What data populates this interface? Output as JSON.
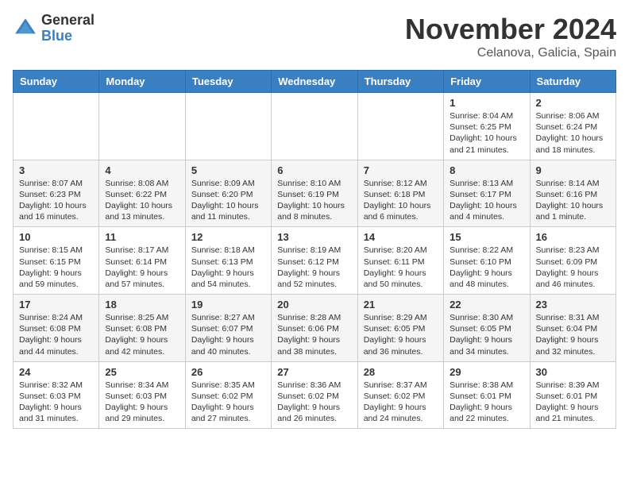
{
  "logo": {
    "general": "General",
    "blue": "Blue"
  },
  "header": {
    "title": "November 2024",
    "location": "Celanova, Galicia, Spain"
  },
  "weekdays": [
    "Sunday",
    "Monday",
    "Tuesday",
    "Wednesday",
    "Thursday",
    "Friday",
    "Saturday"
  ],
  "weeks": [
    [
      {
        "day": "",
        "info": ""
      },
      {
        "day": "",
        "info": ""
      },
      {
        "day": "",
        "info": ""
      },
      {
        "day": "",
        "info": ""
      },
      {
        "day": "",
        "info": ""
      },
      {
        "day": "1",
        "info": "Sunrise: 8:04 AM\nSunset: 6:25 PM\nDaylight: 10 hours and 21 minutes."
      },
      {
        "day": "2",
        "info": "Sunrise: 8:06 AM\nSunset: 6:24 PM\nDaylight: 10 hours and 18 minutes."
      }
    ],
    [
      {
        "day": "3",
        "info": "Sunrise: 8:07 AM\nSunset: 6:23 PM\nDaylight: 10 hours and 16 minutes."
      },
      {
        "day": "4",
        "info": "Sunrise: 8:08 AM\nSunset: 6:22 PM\nDaylight: 10 hours and 13 minutes."
      },
      {
        "day": "5",
        "info": "Sunrise: 8:09 AM\nSunset: 6:20 PM\nDaylight: 10 hours and 11 minutes."
      },
      {
        "day": "6",
        "info": "Sunrise: 8:10 AM\nSunset: 6:19 PM\nDaylight: 10 hours and 8 minutes."
      },
      {
        "day": "7",
        "info": "Sunrise: 8:12 AM\nSunset: 6:18 PM\nDaylight: 10 hours and 6 minutes."
      },
      {
        "day": "8",
        "info": "Sunrise: 8:13 AM\nSunset: 6:17 PM\nDaylight: 10 hours and 4 minutes."
      },
      {
        "day": "9",
        "info": "Sunrise: 8:14 AM\nSunset: 6:16 PM\nDaylight: 10 hours and 1 minute."
      }
    ],
    [
      {
        "day": "10",
        "info": "Sunrise: 8:15 AM\nSunset: 6:15 PM\nDaylight: 9 hours and 59 minutes."
      },
      {
        "day": "11",
        "info": "Sunrise: 8:17 AM\nSunset: 6:14 PM\nDaylight: 9 hours and 57 minutes."
      },
      {
        "day": "12",
        "info": "Sunrise: 8:18 AM\nSunset: 6:13 PM\nDaylight: 9 hours and 54 minutes."
      },
      {
        "day": "13",
        "info": "Sunrise: 8:19 AM\nSunset: 6:12 PM\nDaylight: 9 hours and 52 minutes."
      },
      {
        "day": "14",
        "info": "Sunrise: 8:20 AM\nSunset: 6:11 PM\nDaylight: 9 hours and 50 minutes."
      },
      {
        "day": "15",
        "info": "Sunrise: 8:22 AM\nSunset: 6:10 PM\nDaylight: 9 hours and 48 minutes."
      },
      {
        "day": "16",
        "info": "Sunrise: 8:23 AM\nSunset: 6:09 PM\nDaylight: 9 hours and 46 minutes."
      }
    ],
    [
      {
        "day": "17",
        "info": "Sunrise: 8:24 AM\nSunset: 6:08 PM\nDaylight: 9 hours and 44 minutes."
      },
      {
        "day": "18",
        "info": "Sunrise: 8:25 AM\nSunset: 6:08 PM\nDaylight: 9 hours and 42 minutes."
      },
      {
        "day": "19",
        "info": "Sunrise: 8:27 AM\nSunset: 6:07 PM\nDaylight: 9 hours and 40 minutes."
      },
      {
        "day": "20",
        "info": "Sunrise: 8:28 AM\nSunset: 6:06 PM\nDaylight: 9 hours and 38 minutes."
      },
      {
        "day": "21",
        "info": "Sunrise: 8:29 AM\nSunset: 6:05 PM\nDaylight: 9 hours and 36 minutes."
      },
      {
        "day": "22",
        "info": "Sunrise: 8:30 AM\nSunset: 6:05 PM\nDaylight: 9 hours and 34 minutes."
      },
      {
        "day": "23",
        "info": "Sunrise: 8:31 AM\nSunset: 6:04 PM\nDaylight: 9 hours and 32 minutes."
      }
    ],
    [
      {
        "day": "24",
        "info": "Sunrise: 8:32 AM\nSunset: 6:03 PM\nDaylight: 9 hours and 31 minutes."
      },
      {
        "day": "25",
        "info": "Sunrise: 8:34 AM\nSunset: 6:03 PM\nDaylight: 9 hours and 29 minutes."
      },
      {
        "day": "26",
        "info": "Sunrise: 8:35 AM\nSunset: 6:02 PM\nDaylight: 9 hours and 27 minutes."
      },
      {
        "day": "27",
        "info": "Sunrise: 8:36 AM\nSunset: 6:02 PM\nDaylight: 9 hours and 26 minutes."
      },
      {
        "day": "28",
        "info": "Sunrise: 8:37 AM\nSunset: 6:02 PM\nDaylight: 9 hours and 24 minutes."
      },
      {
        "day": "29",
        "info": "Sunrise: 8:38 AM\nSunset: 6:01 PM\nDaylight: 9 hours and 22 minutes."
      },
      {
        "day": "30",
        "info": "Sunrise: 8:39 AM\nSunset: 6:01 PM\nDaylight: 9 hours and 21 minutes."
      }
    ]
  ]
}
